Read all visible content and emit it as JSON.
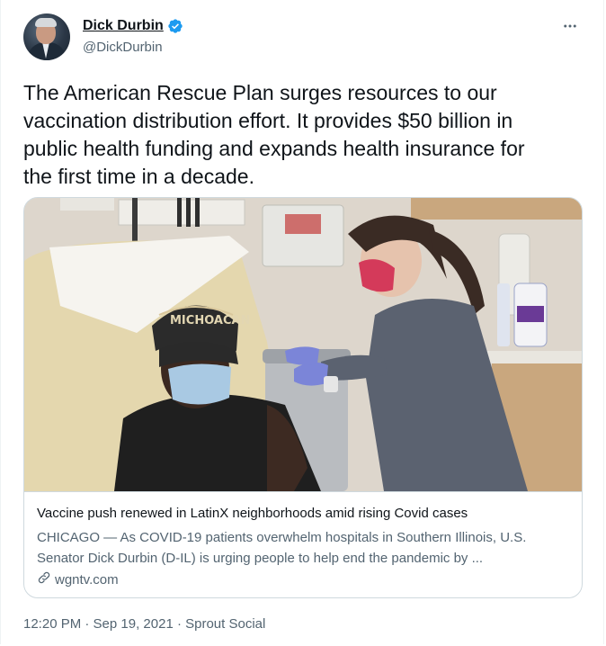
{
  "author": {
    "display_name": "Dick Durbin",
    "handle": "@DickDurbin",
    "verified": true,
    "avatar_icon": "profile-photo"
  },
  "tweet": {
    "text": "The American Rescue Plan surges resources to our\nvaccination distribution effort. It provides $50 billion in\npublic health funding and expands health insurance for\nthe first time in a decade."
  },
  "card": {
    "image_icon": "vaccination-photo",
    "cap_text": "MICHOACAN",
    "title": "Vaccine push renewed in LatinX neighborhoods amid rising Covid cases",
    "description": "CHICAGO — As COVID-19 patients overwhelm hospitals in Southern Illinois, U.S. Senator Dick Durbin (D-IL) is urging people to help end the pandemic by ...",
    "domain": "wgntv.com",
    "link_icon": "link-icon"
  },
  "meta": {
    "timestamp": "12:20 PM · Sep 19, 2021 · Sprout Social"
  },
  "colors": {
    "text_primary": "#0f1419",
    "text_secondary": "#536471",
    "verified_blue": "#1d9bf0",
    "border": "#cfd9de"
  }
}
